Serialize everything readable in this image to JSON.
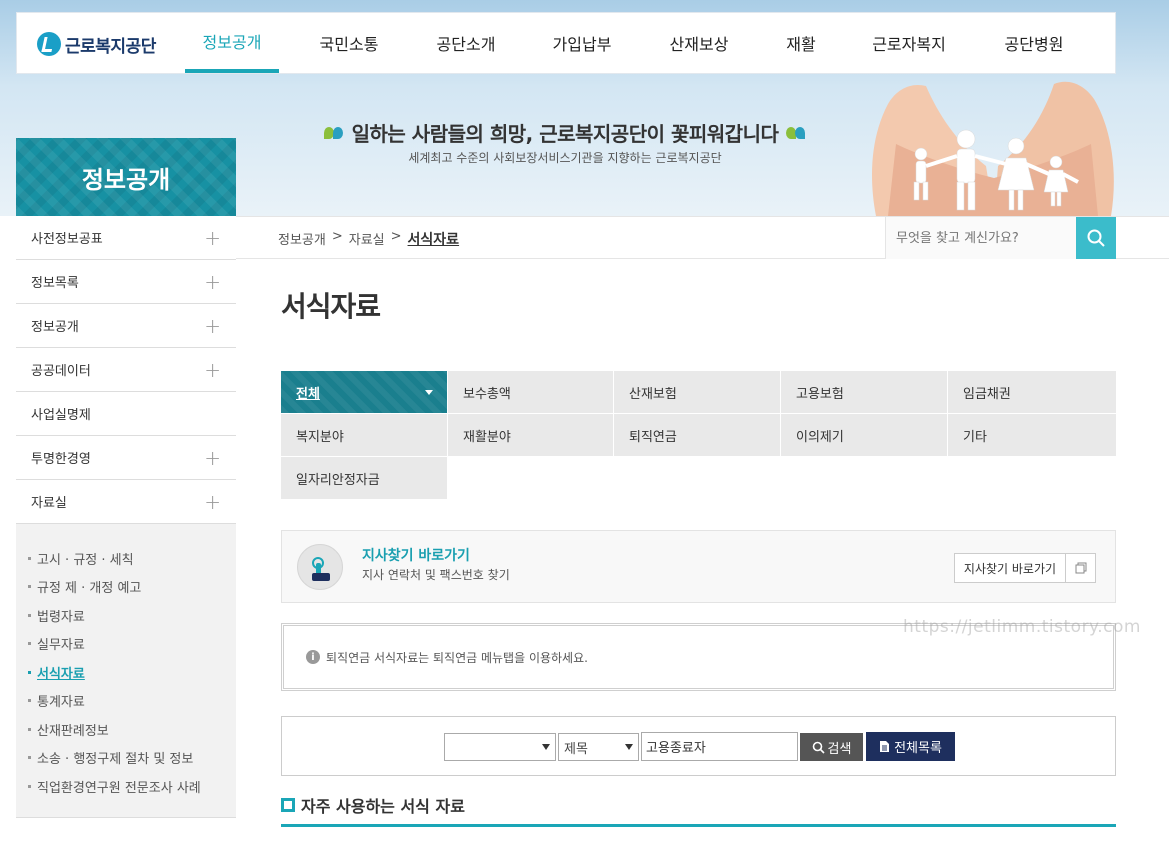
{
  "header": {
    "logo_text": "근로복지공단",
    "nav": [
      {
        "label": "정보공개",
        "active": true
      },
      {
        "label": "국민소통",
        "active": false
      },
      {
        "label": "공단소개",
        "active": false
      },
      {
        "label": "가입납부",
        "active": false
      },
      {
        "label": "산재보상",
        "active": false
      },
      {
        "label": "재활",
        "active": false
      },
      {
        "label": "근로자복지",
        "active": false
      },
      {
        "label": "공단병원",
        "active": false
      }
    ]
  },
  "banner": {
    "slogan": "일하는 사람들의 희망, 근로복지공단이 꽃피워갑니다",
    "subslogan": "세계최고 수준의 사회보장서비스기관을 지향하는 근로복지공단"
  },
  "sidebar": {
    "title": "정보공개",
    "items": [
      {
        "label": "사전정보공표",
        "expandable": true
      },
      {
        "label": "정보목록",
        "expandable": true
      },
      {
        "label": "정보공개",
        "expandable": true
      },
      {
        "label": "공공데이터",
        "expandable": true
      },
      {
        "label": "사업실명제",
        "expandable": false
      },
      {
        "label": "투명한경영",
        "expandable": true
      },
      {
        "label": "자료실",
        "expandable": true
      }
    ],
    "subitems": [
      {
        "label": "고시 · 규정 · 세칙"
      },
      {
        "label": "규정 제 · 개정 예고"
      },
      {
        "label": "법령자료"
      },
      {
        "label": "실무자료"
      },
      {
        "label": "서식자료",
        "active": true
      },
      {
        "label": "통계자료"
      },
      {
        "label": "산재판례정보"
      },
      {
        "label": "소송 · 행정구제 절차 및 정보"
      },
      {
        "label": "직업환경연구원 전문조사 사례"
      }
    ],
    "plus": "+"
  },
  "breadcrumb": {
    "items": [
      "정보공개",
      "자료실",
      "서식자료"
    ],
    "sep": ">"
  },
  "search": {
    "placeholder": "무엇을 찾고 계신가요?"
  },
  "page_title": "서식자료",
  "tabs": [
    {
      "label": "전체",
      "active": true
    },
    {
      "label": "보수총액"
    },
    {
      "label": "산재보험"
    },
    {
      "label": "고용보험"
    },
    {
      "label": "임금채권"
    },
    {
      "label": "복지분야"
    },
    {
      "label": "재활분야"
    },
    {
      "label": "퇴직연금"
    },
    {
      "label": "이의제기"
    },
    {
      "label": "기타"
    },
    {
      "label": "일자리안정자금"
    }
  ],
  "branch": {
    "title": "지사찾기 바로가기",
    "desc": "지사 연락처 및 팩스번호 찾기",
    "button": "지사찾기 바로가기"
  },
  "notice": {
    "icon": "i",
    "text": "퇴직연금 서식자료는 퇴직연금 메뉴탭을 이용하세요."
  },
  "watermark": "https://jetlimm.tistory.com",
  "form": {
    "category_value": "",
    "field_value": "제목",
    "keyword": "고용종료자",
    "search_button": "검색",
    "all_button": "전체목록"
  },
  "section_title": "자주 사용하는 서식 자료",
  "colors": {
    "accent": "#1aa6b7",
    "navy": "#1e2f5e",
    "tab_active": "#1a7f8e"
  },
  "icons": [
    "search-icon",
    "plus-icon",
    "quote-open-icon",
    "quote-close-icon",
    "caret-down-icon",
    "info-icon",
    "copy-icon",
    "document-icon",
    "finger-tap-icon"
  ]
}
